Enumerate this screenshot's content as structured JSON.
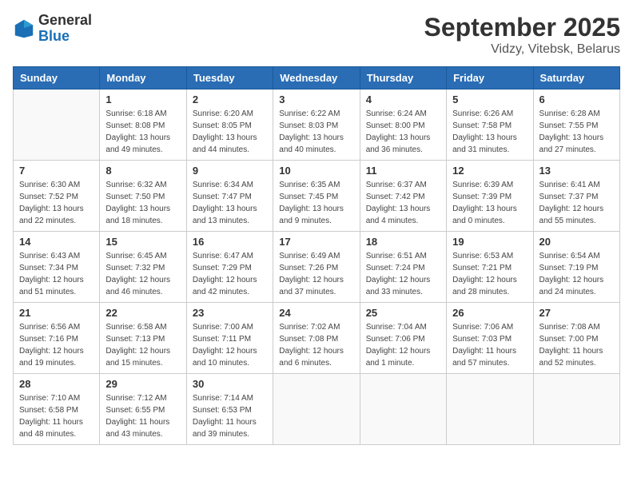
{
  "header": {
    "logo_general": "General",
    "logo_blue": "Blue",
    "month": "September 2025",
    "location": "Vidzy, Vitebsk, Belarus"
  },
  "days_of_week": [
    "Sunday",
    "Monday",
    "Tuesday",
    "Wednesday",
    "Thursday",
    "Friday",
    "Saturday"
  ],
  "weeks": [
    [
      {
        "day": "",
        "sunrise": "",
        "sunset": "",
        "daylight": ""
      },
      {
        "day": "1",
        "sunrise": "Sunrise: 6:18 AM",
        "sunset": "Sunset: 8:08 PM",
        "daylight": "Daylight: 13 hours and 49 minutes."
      },
      {
        "day": "2",
        "sunrise": "Sunrise: 6:20 AM",
        "sunset": "Sunset: 8:05 PM",
        "daylight": "Daylight: 13 hours and 44 minutes."
      },
      {
        "day": "3",
        "sunrise": "Sunrise: 6:22 AM",
        "sunset": "Sunset: 8:03 PM",
        "daylight": "Daylight: 13 hours and 40 minutes."
      },
      {
        "day": "4",
        "sunrise": "Sunrise: 6:24 AM",
        "sunset": "Sunset: 8:00 PM",
        "daylight": "Daylight: 13 hours and 36 minutes."
      },
      {
        "day": "5",
        "sunrise": "Sunrise: 6:26 AM",
        "sunset": "Sunset: 7:58 PM",
        "daylight": "Daylight: 13 hours and 31 minutes."
      },
      {
        "day": "6",
        "sunrise": "Sunrise: 6:28 AM",
        "sunset": "Sunset: 7:55 PM",
        "daylight": "Daylight: 13 hours and 27 minutes."
      }
    ],
    [
      {
        "day": "7",
        "sunrise": "Sunrise: 6:30 AM",
        "sunset": "Sunset: 7:52 PM",
        "daylight": "Daylight: 13 hours and 22 minutes."
      },
      {
        "day": "8",
        "sunrise": "Sunrise: 6:32 AM",
        "sunset": "Sunset: 7:50 PM",
        "daylight": "Daylight: 13 hours and 18 minutes."
      },
      {
        "day": "9",
        "sunrise": "Sunrise: 6:34 AM",
        "sunset": "Sunset: 7:47 PM",
        "daylight": "Daylight: 13 hours and 13 minutes."
      },
      {
        "day": "10",
        "sunrise": "Sunrise: 6:35 AM",
        "sunset": "Sunset: 7:45 PM",
        "daylight": "Daylight: 13 hours and 9 minutes."
      },
      {
        "day": "11",
        "sunrise": "Sunrise: 6:37 AM",
        "sunset": "Sunset: 7:42 PM",
        "daylight": "Daylight: 13 hours and 4 minutes."
      },
      {
        "day": "12",
        "sunrise": "Sunrise: 6:39 AM",
        "sunset": "Sunset: 7:39 PM",
        "daylight": "Daylight: 13 hours and 0 minutes."
      },
      {
        "day": "13",
        "sunrise": "Sunrise: 6:41 AM",
        "sunset": "Sunset: 7:37 PM",
        "daylight": "Daylight: 12 hours and 55 minutes."
      }
    ],
    [
      {
        "day": "14",
        "sunrise": "Sunrise: 6:43 AM",
        "sunset": "Sunset: 7:34 PM",
        "daylight": "Daylight: 12 hours and 51 minutes."
      },
      {
        "day": "15",
        "sunrise": "Sunrise: 6:45 AM",
        "sunset": "Sunset: 7:32 PM",
        "daylight": "Daylight: 12 hours and 46 minutes."
      },
      {
        "day": "16",
        "sunrise": "Sunrise: 6:47 AM",
        "sunset": "Sunset: 7:29 PM",
        "daylight": "Daylight: 12 hours and 42 minutes."
      },
      {
        "day": "17",
        "sunrise": "Sunrise: 6:49 AM",
        "sunset": "Sunset: 7:26 PM",
        "daylight": "Daylight: 12 hours and 37 minutes."
      },
      {
        "day": "18",
        "sunrise": "Sunrise: 6:51 AM",
        "sunset": "Sunset: 7:24 PM",
        "daylight": "Daylight: 12 hours and 33 minutes."
      },
      {
        "day": "19",
        "sunrise": "Sunrise: 6:53 AM",
        "sunset": "Sunset: 7:21 PM",
        "daylight": "Daylight: 12 hours and 28 minutes."
      },
      {
        "day": "20",
        "sunrise": "Sunrise: 6:54 AM",
        "sunset": "Sunset: 7:19 PM",
        "daylight": "Daylight: 12 hours and 24 minutes."
      }
    ],
    [
      {
        "day": "21",
        "sunrise": "Sunrise: 6:56 AM",
        "sunset": "Sunset: 7:16 PM",
        "daylight": "Daylight: 12 hours and 19 minutes."
      },
      {
        "day": "22",
        "sunrise": "Sunrise: 6:58 AM",
        "sunset": "Sunset: 7:13 PM",
        "daylight": "Daylight: 12 hours and 15 minutes."
      },
      {
        "day": "23",
        "sunrise": "Sunrise: 7:00 AM",
        "sunset": "Sunset: 7:11 PM",
        "daylight": "Daylight: 12 hours and 10 minutes."
      },
      {
        "day": "24",
        "sunrise": "Sunrise: 7:02 AM",
        "sunset": "Sunset: 7:08 PM",
        "daylight": "Daylight: 12 hours and 6 minutes."
      },
      {
        "day": "25",
        "sunrise": "Sunrise: 7:04 AM",
        "sunset": "Sunset: 7:06 PM",
        "daylight": "Daylight: 12 hours and 1 minute."
      },
      {
        "day": "26",
        "sunrise": "Sunrise: 7:06 AM",
        "sunset": "Sunset: 7:03 PM",
        "daylight": "Daylight: 11 hours and 57 minutes."
      },
      {
        "day": "27",
        "sunrise": "Sunrise: 7:08 AM",
        "sunset": "Sunset: 7:00 PM",
        "daylight": "Daylight: 11 hours and 52 minutes."
      }
    ],
    [
      {
        "day": "28",
        "sunrise": "Sunrise: 7:10 AM",
        "sunset": "Sunset: 6:58 PM",
        "daylight": "Daylight: 11 hours and 48 minutes."
      },
      {
        "day": "29",
        "sunrise": "Sunrise: 7:12 AM",
        "sunset": "Sunset: 6:55 PM",
        "daylight": "Daylight: 11 hours and 43 minutes."
      },
      {
        "day": "30",
        "sunrise": "Sunrise: 7:14 AM",
        "sunset": "Sunset: 6:53 PM",
        "daylight": "Daylight: 11 hours and 39 minutes."
      },
      {
        "day": "",
        "sunrise": "",
        "sunset": "",
        "daylight": ""
      },
      {
        "day": "",
        "sunrise": "",
        "sunset": "",
        "daylight": ""
      },
      {
        "day": "",
        "sunrise": "",
        "sunset": "",
        "daylight": ""
      },
      {
        "day": "",
        "sunrise": "",
        "sunset": "",
        "daylight": ""
      }
    ]
  ]
}
